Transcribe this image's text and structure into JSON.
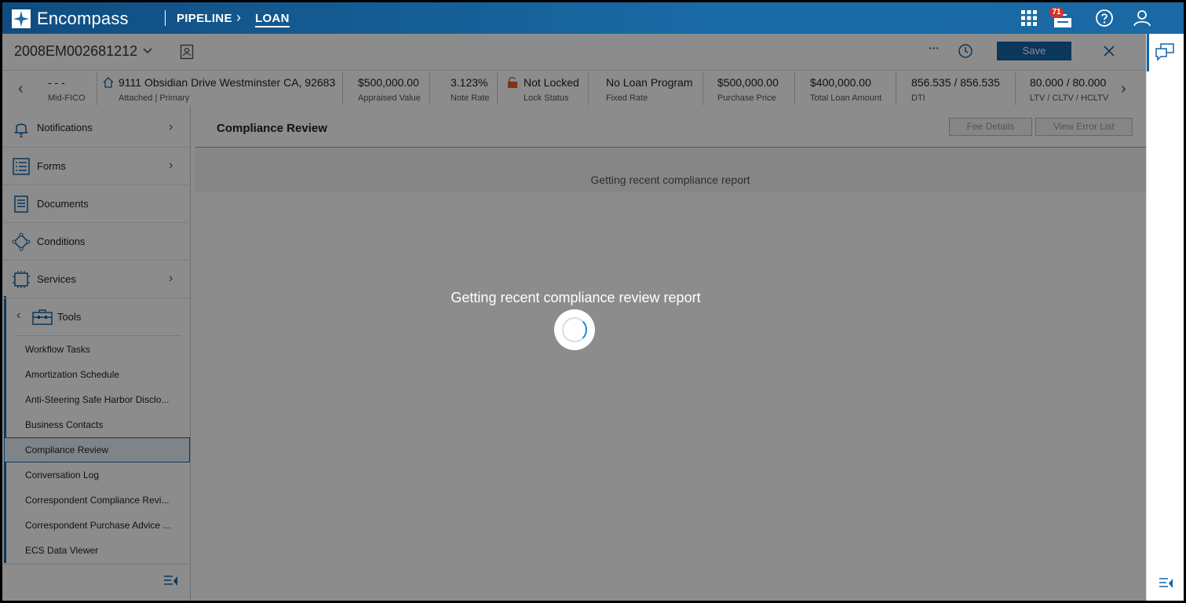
{
  "app": {
    "brand": "Encompass",
    "breadcrumb": {
      "pipeline": "PIPELINE",
      "separator": "›",
      "current": "LOAN"
    },
    "notification_count": "71"
  },
  "loan_header": {
    "loan_number": "2008EM002681212",
    "more_label": "···",
    "save_label": "Save"
  },
  "summary": [
    {
      "value": "- - -",
      "label": "Mid-FICO"
    },
    {
      "value": "9111 Obsidian Drive Westminster CA, 92683",
      "label": "Attached | Primary"
    },
    {
      "value": "$500,000.00",
      "label": "Appraised Value"
    },
    {
      "value": "3.123%",
      "label": "Note Rate"
    },
    {
      "value": "Not Locked",
      "label": "Lock Status"
    },
    {
      "value": "No Loan Program",
      "label": "Fixed Rate"
    },
    {
      "value": "$500,000.00",
      "label": "Purchase Price"
    },
    {
      "value": "$400,000.00",
      "label": "Total Loan Amount"
    },
    {
      "value": "856.535 / 856.535",
      "label": "DTI"
    },
    {
      "value": "80.000 / 80.000",
      "label": "LTV / CLTV / HCLTV"
    }
  ],
  "nav": {
    "main": [
      {
        "label": "Notifications"
      },
      {
        "label": "Forms"
      },
      {
        "label": "Documents"
      },
      {
        "label": "Conditions"
      },
      {
        "label": "Services"
      }
    ],
    "tools_label": "Tools",
    "tools": [
      {
        "label": "Workflow Tasks"
      },
      {
        "label": "Amortization Schedule"
      },
      {
        "label": "Anti-Steering Safe Harbor Disclo..."
      },
      {
        "label": "Business Contacts"
      },
      {
        "label": "Compliance Review"
      },
      {
        "label": "Conversation Log"
      },
      {
        "label": "Correspondent Compliance Revi..."
      },
      {
        "label": "Correspondent Purchase Advice ..."
      },
      {
        "label": "ECS Data Viewer"
      }
    ],
    "active_tool": "Compliance Review"
  },
  "main": {
    "title": "Compliance Review",
    "fee_details_label": "Fee Details",
    "view_error_list_label": "View Error List",
    "status_text": "Getting recent compliance report"
  },
  "overlay": {
    "loading_text": "Getting recent compliance review report"
  },
  "colors": {
    "accent": "#1565a6",
    "topbar": "#0f4d80",
    "badge": "#d0312d",
    "lock": "#e0622a"
  }
}
